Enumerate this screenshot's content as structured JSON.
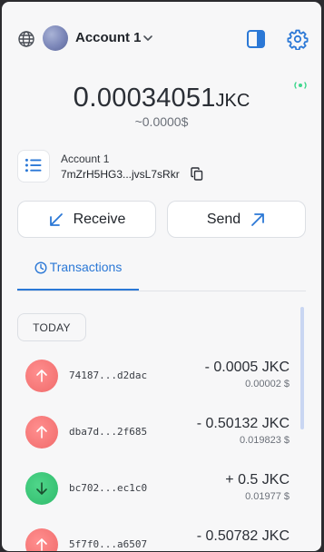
{
  "header": {
    "account_name": "Account 1",
    "icons": {
      "network": "globe-icon",
      "avatar": "avatar",
      "dropdown": "chevron-down-icon",
      "panel": "side-panel-icon",
      "settings": "gear-icon",
      "connection": "connection-status-icon"
    },
    "accent_color": "#2b78d6",
    "connection_color": "#3dd68c"
  },
  "balance": {
    "whole": "0.",
    "fraction": "00034051",
    "unit": "JKC",
    "fiat": "~0.0000$"
  },
  "account_card": {
    "label": "Account 1",
    "address": "7mZrH5HG3...jvsL7sRkr",
    "icons": {
      "list": "list-icon",
      "copy": "copy-icon"
    }
  },
  "actions": {
    "receive_label": "Receive",
    "send_label": "Send"
  },
  "tabs": {
    "transactions_label": "Transactions"
  },
  "transactions": {
    "group_label": "TODAY",
    "items": [
      {
        "hash": "74187...d2dac",
        "amount": "- 0.0005 JKC",
        "fiat": "0.00002 $",
        "direction": "out"
      },
      {
        "hash": "dba7d...2f685",
        "amount": "- 0.50132 JKC",
        "fiat": "0.019823 $",
        "direction": "out"
      },
      {
        "hash": "bc702...ec1c0",
        "amount": "+ 0.5 JKC",
        "fiat": "0.01977 $",
        "direction": "in"
      },
      {
        "hash": "5f7f0...a6507",
        "amount": "- 0.50782 JKC",
        "fiat": "",
        "direction": "out"
      }
    ],
    "colors": {
      "out": "#f06a6a",
      "in": "#2fba6b"
    }
  }
}
